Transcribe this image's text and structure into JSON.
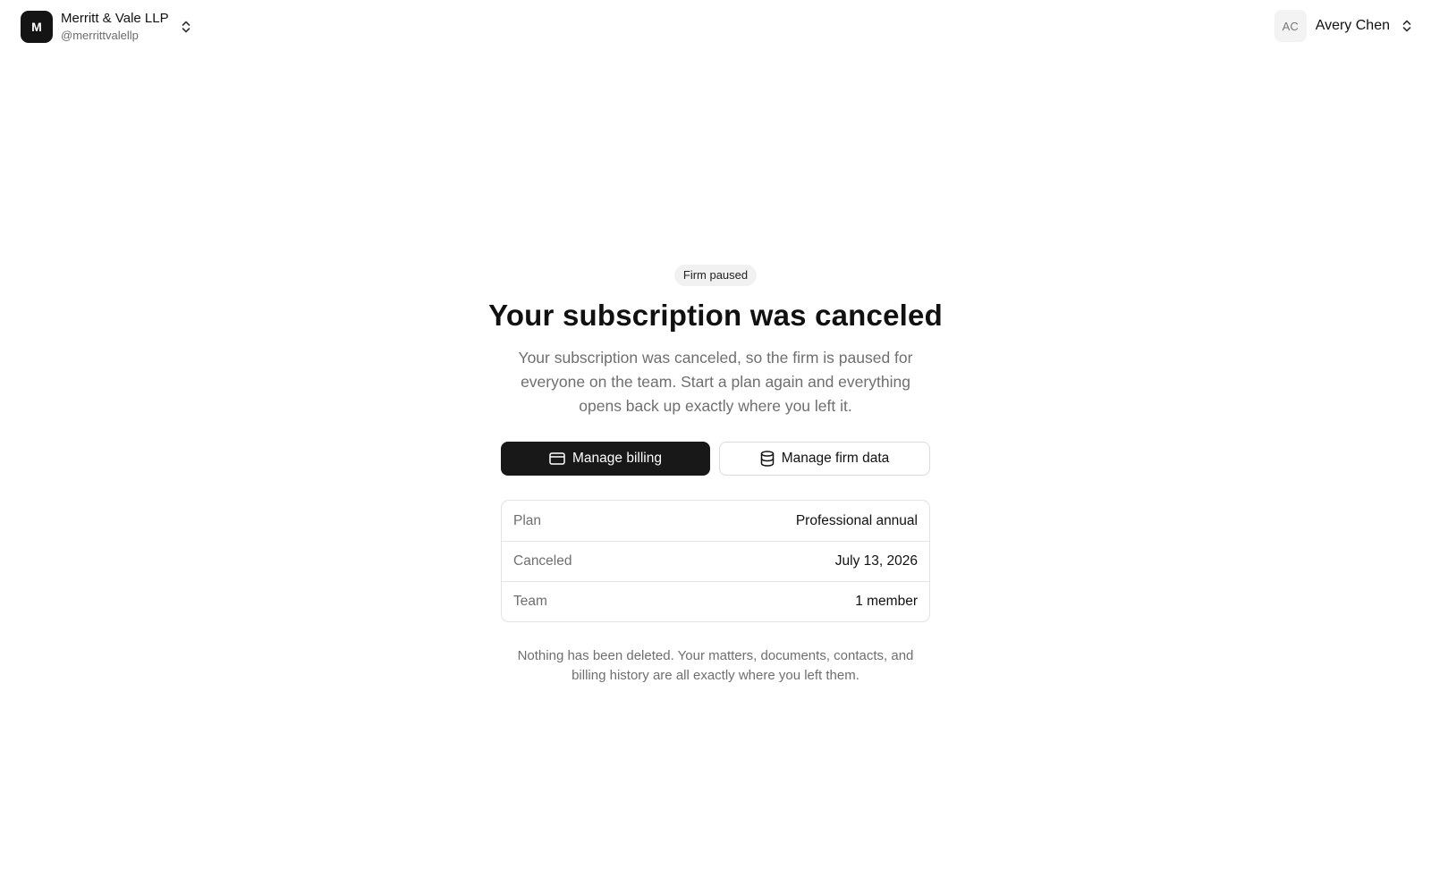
{
  "workspace": {
    "logo_letter": "M",
    "name": "Merritt & Vale LLP",
    "handle": "@merrittvalellp"
  },
  "user": {
    "initials": "AC",
    "name": "Avery Chen"
  },
  "status": {
    "badge": "Firm paused",
    "title": "Your subscription was canceled",
    "description": "Your subscription was canceled, so the firm is paused for everyone on the team. Start a plan again and everything opens back up exactly where you left it."
  },
  "actions": {
    "manage_billing": "Manage billing",
    "manage_firm_data": "Manage firm data"
  },
  "details": [
    {
      "label": "Plan",
      "value": "Professional annual"
    },
    {
      "label": "Canceled",
      "value": "July 13, 2026"
    },
    {
      "label": "Team",
      "value": "1 member"
    }
  ],
  "footnote": "Nothing has been deleted. Your matters, documents, contacts, and billing history are all exactly where you left them.",
  "icons": {
    "workspace_switch": "chevron-up-down-icon",
    "user_switch": "chevron-up-down-icon",
    "billing": "credit-card-icon",
    "data": "database-icon"
  },
  "colors": {
    "primary_button": "#181818",
    "muted_text": "#6f6f6f",
    "badge_bg": "#f1f1f1"
  }
}
